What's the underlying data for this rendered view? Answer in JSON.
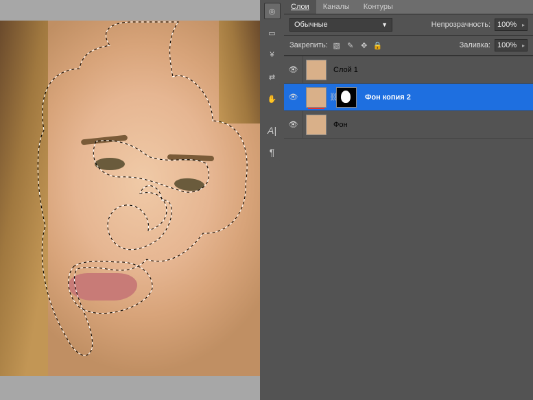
{
  "panel": {
    "tabs": {
      "layers": "Слои",
      "channels": "Каналы",
      "paths": "Контуры"
    },
    "blend_mode": "Обычные",
    "opacity_label": "Непрозрачность:",
    "opacity_value": "100%",
    "lock_label": "Закрепить:",
    "fill_label": "Заливка:",
    "fill_value": "100%"
  },
  "layers": [
    {
      "name": "Слой 1",
      "selected": false,
      "has_mask": false
    },
    {
      "name": "Фон копия 2",
      "selected": true,
      "has_mask": true
    },
    {
      "name": "Фон",
      "selected": false,
      "has_mask": false
    }
  ],
  "tool_icons": [
    "camera",
    "note",
    "brush",
    "swap",
    "hand",
    "text-a",
    "pilcrow"
  ]
}
